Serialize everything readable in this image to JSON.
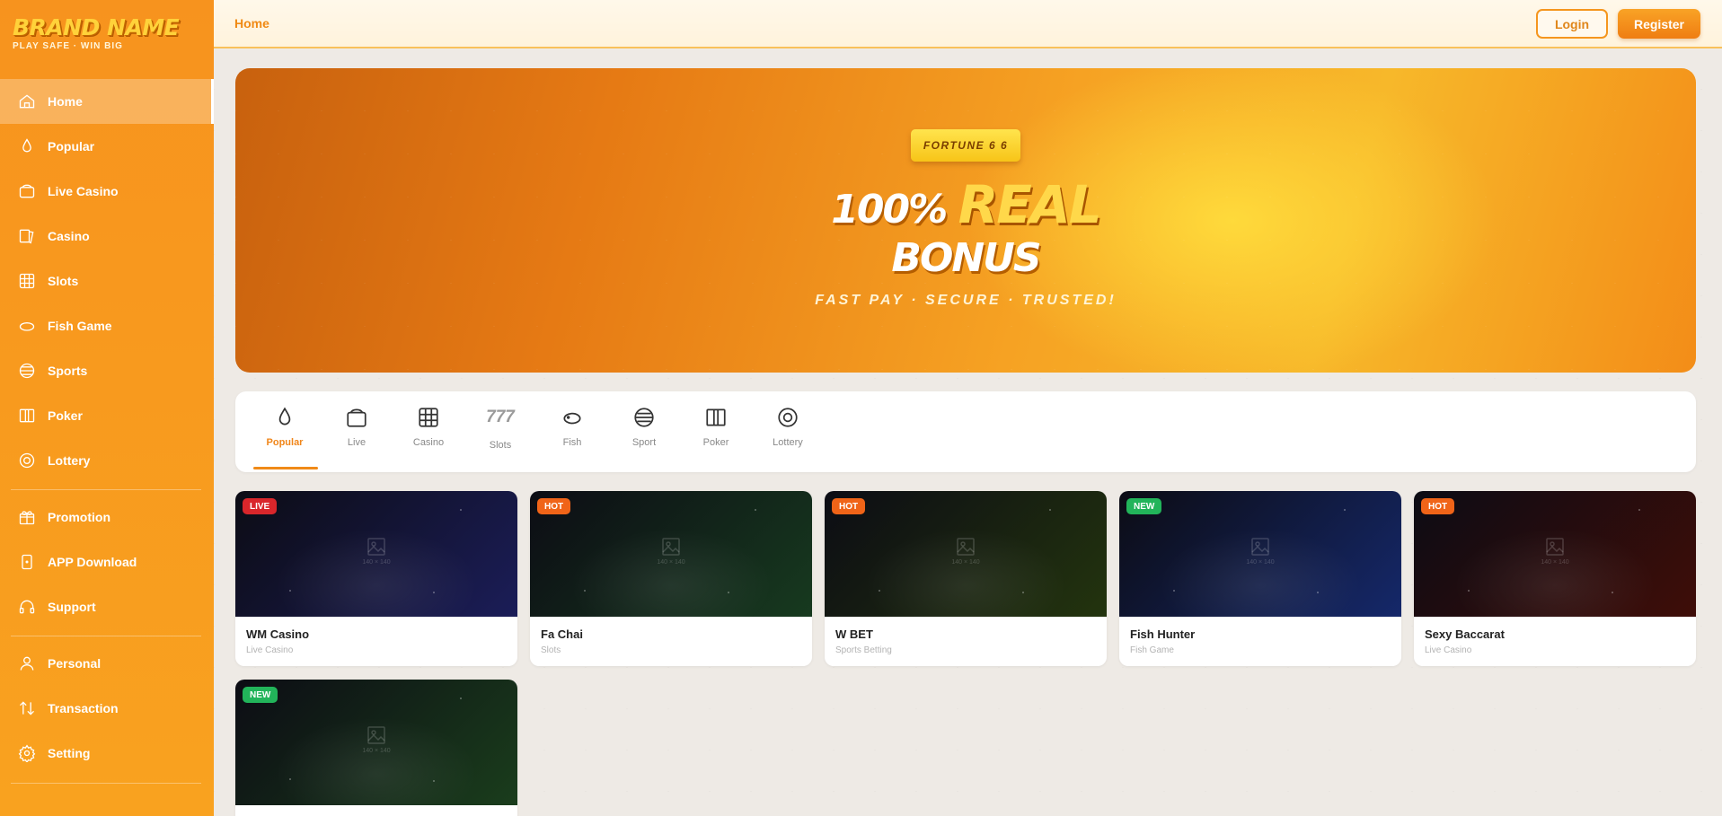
{
  "brand": {
    "name": "BRAND NAME",
    "tagline": "PLAY SAFE · WIN BIG"
  },
  "sidebar": {
    "items": [
      {
        "label": "Home",
        "icon": "home-icon",
        "active": true
      },
      {
        "label": "Popular",
        "icon": "drop-icon"
      },
      {
        "label": "Live Casino",
        "icon": "live-casino-icon"
      },
      {
        "label": "Casino",
        "icon": "cards-icon"
      },
      {
        "label": "Slots",
        "icon": "grid-icon"
      },
      {
        "label": "Fish Game",
        "icon": "fish-icon"
      },
      {
        "label": "Sports",
        "icon": "ball-icon"
      },
      {
        "label": "Poker",
        "icon": "poker-icon"
      },
      {
        "label": "Lottery",
        "icon": "lottery-icon"
      }
    ],
    "secondary": [
      {
        "label": "Promotion",
        "icon": "gift-icon"
      },
      {
        "label": "APP Download",
        "icon": "phone-icon"
      },
      {
        "label": "Support",
        "icon": "headset-icon"
      }
    ],
    "account": [
      {
        "label": "Personal",
        "icon": "user-icon"
      },
      {
        "label": "Transaction",
        "icon": "transfer-icon"
      },
      {
        "label": "Setting",
        "icon": "gear-icon"
      }
    ]
  },
  "header": {
    "breadcrumb": "Home",
    "login_label": "Login",
    "register_label": "Register"
  },
  "banner": {
    "badge": "FORTUNE 6 6",
    "headline_pct": "100%",
    "headline_real": "REAL",
    "headline_bonus": "BONUS",
    "subline": "FAST PAY · SECURE · TRUSTED!"
  },
  "categories": [
    {
      "label": "Popular",
      "icon": "drop-icon",
      "active": true
    },
    {
      "label": "Live",
      "icon": "live-icon"
    },
    {
      "label": "Casino",
      "icon": "grid-icon"
    },
    {
      "label": "Slots",
      "icon": "seven-icon",
      "glyph": "777"
    },
    {
      "label": "Fish",
      "icon": "fish-icon"
    },
    {
      "label": "Sport",
      "icon": "ball-icon"
    },
    {
      "label": "Poker",
      "icon": "poker-icon"
    },
    {
      "label": "Lottery",
      "icon": "lottery-icon"
    }
  ],
  "placeholder_text": "140 × 140",
  "games": [
    {
      "title": "WM Casino",
      "category": "Live Casino",
      "badge": "LIVE",
      "badge_color": "#d9262b",
      "theme": "#1b1d58"
    },
    {
      "title": "Fa Chai",
      "category": "Slots",
      "badge": "HOT",
      "badge_color": "#f06418",
      "theme": "#173a1f"
    },
    {
      "title": "W BET",
      "category": "Sports Betting",
      "badge": "HOT",
      "badge_color": "#f06418",
      "theme": "#23340e"
    },
    {
      "title": "Fish Hunter",
      "category": "Fish Game",
      "badge": "NEW",
      "badge_color": "#22b45a",
      "theme": "#15286a"
    },
    {
      "title": "Sexy Baccarat",
      "category": "Live Casino",
      "badge": "HOT",
      "badge_color": "#f06418",
      "theme": "#3f0d08"
    },
    {
      "title": "",
      "category": "",
      "badge": "NEW",
      "badge_color": "#22b45a",
      "theme": "#1a3d1c"
    }
  ]
}
